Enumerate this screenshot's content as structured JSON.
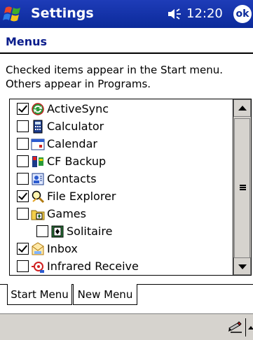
{
  "titlebar": {
    "title": "Settings",
    "time": "12:20",
    "ok_label": "ok"
  },
  "page": {
    "section_title": "Menus",
    "description_line1": "Checked items appear in the Start menu.",
    "description_line2": "Others appear in Programs."
  },
  "items": [
    {
      "label": "ActiveSync",
      "checked": true,
      "icon": "activesync-icon",
      "indent": 0
    },
    {
      "label": "Calculator",
      "checked": false,
      "icon": "calculator-icon",
      "indent": 0
    },
    {
      "label": "Calendar",
      "checked": false,
      "icon": "calendar-icon",
      "indent": 0
    },
    {
      "label": "CF Backup",
      "checked": false,
      "icon": "cf-backup-icon",
      "indent": 0
    },
    {
      "label": "Contacts",
      "checked": false,
      "icon": "contacts-icon",
      "indent": 0
    },
    {
      "label": "File Explorer",
      "checked": true,
      "icon": "file-explorer-icon",
      "indent": 0
    },
    {
      "label": "Games",
      "checked": false,
      "icon": "games-folder-icon",
      "indent": 0
    },
    {
      "label": "Solitaire",
      "checked": false,
      "icon": "solitaire-icon",
      "indent": 1
    },
    {
      "label": "Inbox",
      "checked": true,
      "icon": "inbox-icon",
      "indent": 0
    },
    {
      "label": "Infrared Receive",
      "checked": false,
      "icon": "infrared-icon",
      "indent": 0
    }
  ],
  "tabs": [
    {
      "label": "Start Menu",
      "active": true
    },
    {
      "label": "New Menu",
      "active": false
    }
  ],
  "colors": {
    "titlebar": "#0b2a9a",
    "section_title": "#0a1d8c",
    "menubar": "#d6d3ce"
  }
}
